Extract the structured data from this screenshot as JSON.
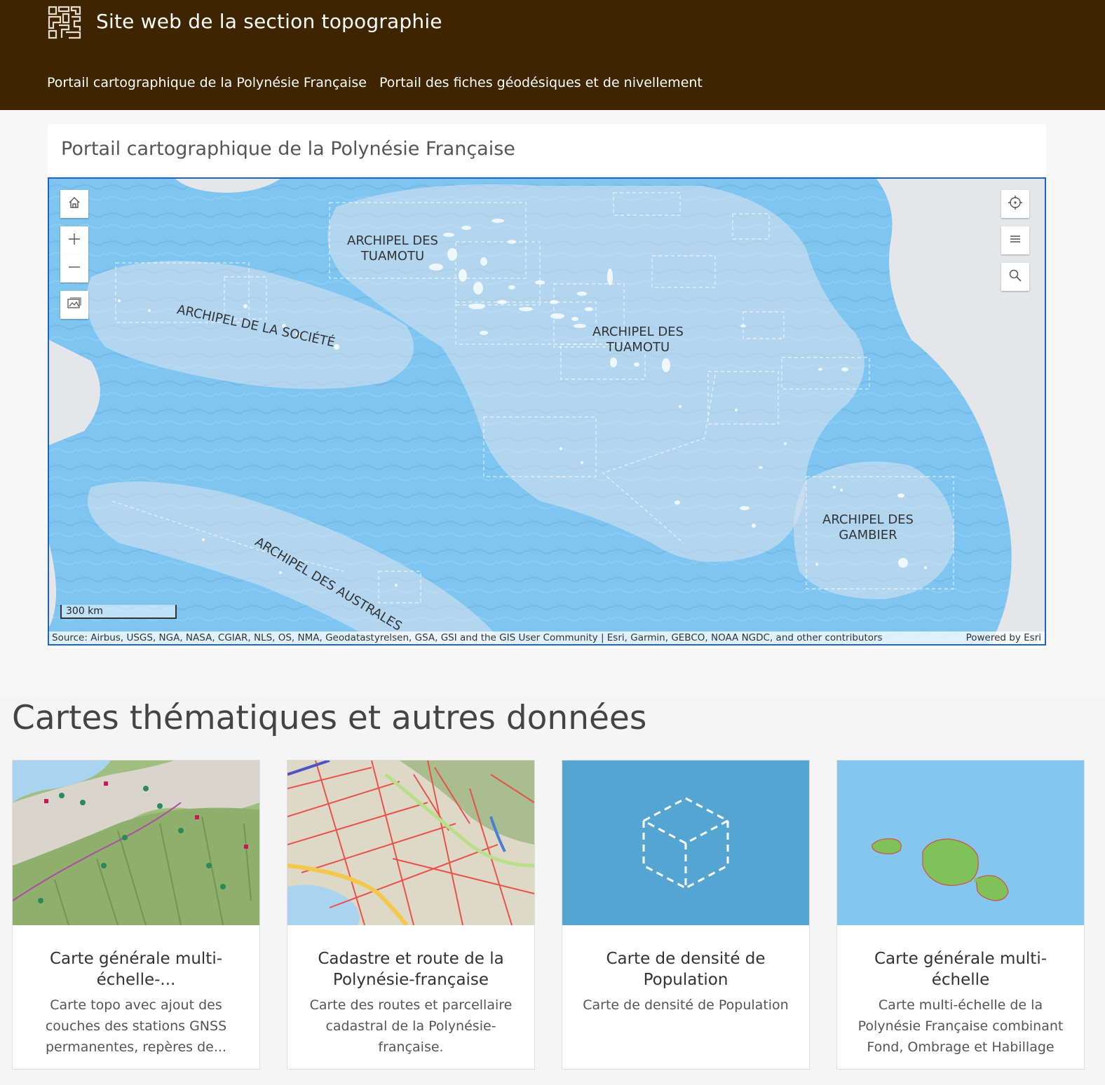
{
  "header": {
    "site_title": "Site web de la section topographie",
    "nav": [
      {
        "label": "Portail cartographique de la Polynésie Française"
      },
      {
        "label": "Portail des fiches géodésiques et de nivellement"
      }
    ]
  },
  "map_card": {
    "title": "Portail cartographique de la Polynésie Française",
    "labels": {
      "tuamotu_north": "ARCHIPEL DES\nTUAMOTU",
      "societe": "ARCHIPEL DE LA SOCIÉTÉ",
      "tuamotu_center": "ARCHIPEL DES\nTUAMOTU",
      "australes": "ARCHIPEL DES AUSTRALES",
      "gambier": "ARCHIPEL DES\nGAMBIER"
    },
    "scale": "300 km",
    "attribution": "Source: Airbus, USGS, NGA, NASA, CGIAR, NLS, OS, NMA, Geodatastyrelsen, GSA, GSI and the GIS User Community | Esri, Garmin, GEBCO, NOAA NGDC, and other contributors",
    "powered_by": "Powered by Esri",
    "controls_left": [
      "home-icon",
      "zoom-in-icon",
      "zoom-out-icon",
      "basemap-icon"
    ],
    "controls_right": [
      "locate-icon",
      "layers-list-icon",
      "search-icon"
    ]
  },
  "section": {
    "title": "Cartes thématiques et autres données",
    "cards": [
      {
        "title": "Carte générale multi-échelle-...",
        "desc": "Carte topo avec ajout des couches des stations GNSS permanentes, repères de..."
      },
      {
        "title": "Cadastre et route de la Polynésie-française",
        "desc": "Carte des routes et parcellaire cadastral de la Polynésie-française."
      },
      {
        "title": "Carte de densité de Population",
        "desc": "Carte de densité de Population"
      },
      {
        "title": "Carte générale multi-échelle",
        "desc": "Carte multi-échelle de la Polynésie Française combinant Fond, Ombrage et Habillage"
      }
    ]
  },
  "colors": {
    "header_bg": "#3e2500",
    "map_ocean": "#7ec5f1",
    "map_border": "#1e64c8",
    "cube_tile": "#55a5d2"
  }
}
